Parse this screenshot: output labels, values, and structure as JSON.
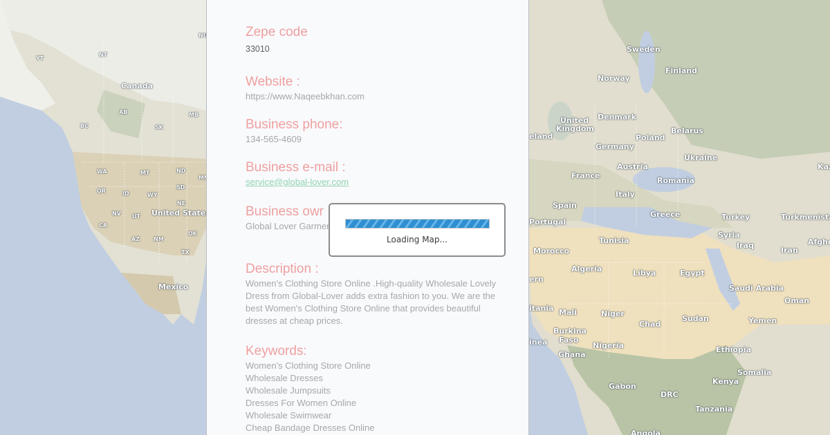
{
  "map": {
    "labels": [
      {
        "text": "NU",
        "tier": "s"
      },
      {
        "text": "NT",
        "tier": "s"
      },
      {
        "text": "YT",
        "tier": "s"
      },
      {
        "text": "Canada",
        "tier": "c"
      },
      {
        "text": "AB",
        "tier": "s"
      },
      {
        "text": "MB",
        "tier": "s"
      },
      {
        "text": "BC",
        "tier": "s"
      },
      {
        "text": "SK",
        "tier": "s"
      },
      {
        "text": "WA",
        "tier": "s"
      },
      {
        "text": "MT",
        "tier": "s"
      },
      {
        "text": "ND",
        "tier": "s"
      },
      {
        "text": "MN",
        "tier": "s"
      },
      {
        "text": "OR",
        "tier": "s"
      },
      {
        "text": "ID",
        "tier": "s"
      },
      {
        "text": "WY",
        "tier": "s"
      },
      {
        "text": "SD",
        "tier": "s"
      },
      {
        "text": "NE",
        "tier": "s"
      },
      {
        "text": "NV",
        "tier": "s"
      },
      {
        "text": "UT",
        "tier": "s"
      },
      {
        "text": "United States",
        "tier": "c"
      },
      {
        "text": "CA",
        "tier": "s"
      },
      {
        "text": "AZ",
        "tier": "s"
      },
      {
        "text": "NM",
        "tier": "s"
      },
      {
        "text": "OK",
        "tier": "s"
      },
      {
        "text": "TX",
        "tier": "s"
      },
      {
        "text": "Mexico",
        "tier": "c"
      },
      {
        "text": "Sweden",
        "tier": "c"
      },
      {
        "text": "Finland",
        "tier": "c"
      },
      {
        "text": "Norway",
        "tier": "c"
      },
      {
        "text": "United",
        "tier": "c"
      },
      {
        "text": "Kingdom",
        "tier": "c"
      },
      {
        "text": "Denmark",
        "tier": "c"
      },
      {
        "text": "Belarus",
        "tier": "c"
      },
      {
        "text": "eland",
        "tier": "c"
      },
      {
        "text": "Poland",
        "tier": "c"
      },
      {
        "text": "Germany",
        "tier": "c"
      },
      {
        "text": "Ukraine",
        "tier": "c"
      },
      {
        "text": "Kaz",
        "tier": "c"
      },
      {
        "text": "Austria",
        "tier": "c"
      },
      {
        "text": "France",
        "tier": "c"
      },
      {
        "text": "Romania",
        "tier": "c"
      },
      {
        "text": "Italy",
        "tier": "c"
      },
      {
        "text": "Spain",
        "tier": "c"
      },
      {
        "text": "Portugal",
        "tier": "c"
      },
      {
        "text": "Greece",
        "tier": "c"
      },
      {
        "text": "Turkey",
        "tier": "c"
      },
      {
        "text": "Turkmenista",
        "tier": "c"
      },
      {
        "text": "Tunisia",
        "tier": "c"
      },
      {
        "text": "Syria",
        "tier": "c"
      },
      {
        "text": "Iraq",
        "tier": "c"
      },
      {
        "text": "Afghe",
        "tier": "c"
      },
      {
        "text": "Morocco",
        "tier": "c"
      },
      {
        "text": "Iran",
        "tier": "c"
      },
      {
        "text": "Algeria",
        "tier": "c"
      },
      {
        "text": "Libya",
        "tier": "c"
      },
      {
        "text": "Egypt",
        "tier": "c"
      },
      {
        "text": "Saudi Arabia",
        "tier": "c"
      },
      {
        "text": "Oman",
        "tier": "c"
      },
      {
        "text": "Mali",
        "tier": "c"
      },
      {
        "text": "Niger",
        "tier": "c"
      },
      {
        "text": "Chad",
        "tier": "c"
      },
      {
        "text": "Sudan",
        "tier": "c"
      },
      {
        "text": "Yemen",
        "tier": "c"
      },
      {
        "text": "Burkina",
        "tier": "c"
      },
      {
        "text": "Faso",
        "tier": "c"
      },
      {
        "text": "Nigeria",
        "tier": "c"
      },
      {
        "text": "Ethiopia",
        "tier": "c"
      },
      {
        "text": "Ghana",
        "tier": "c"
      },
      {
        "text": "Kenya",
        "tier": "c"
      },
      {
        "text": "Somalia",
        "tier": "c"
      },
      {
        "text": "Gabon",
        "tier": "c"
      },
      {
        "text": "DRC",
        "tier": "c"
      },
      {
        "text": "Tanzania",
        "tier": "c"
      },
      {
        "text": "Angola",
        "tier": "c"
      },
      {
        "text": "ern",
        "tier": "c"
      },
      {
        "text": "itania",
        "tier": "c"
      },
      {
        "text": "inea",
        "tier": "c"
      }
    ]
  },
  "info": {
    "zip_heading": "Zepe code",
    "zip_value": "33010",
    "website_heading": "Website :",
    "website_value": "https://www.Naqeebkhan.com",
    "phone_heading": "Business phone:",
    "phone_value": "134-565-4609",
    "email_heading": "Business e-mail :",
    "email_value": "service@global-lover.com",
    "owner_heading": "Business owr",
    "owner_value": "Global Lover Garmer",
    "description_heading": "Description :",
    "description_value": "Women's Clothing Store Online .High-quality Wholesale Lovely Dress from Global-Lover adds extra fashion to you. We are the best Women's Clothing Store Online that provides beautiful dresses at cheap prices.",
    "keywords_heading": "Keywords:",
    "keywords": [
      "Women's Clothing Store Online",
      "Wholesale Dresses",
      "Wholesale Jumpsuits",
      "Dresses For Women Online",
      "Wholesale Swimwear",
      "Cheap Bandage Dresses Online"
    ]
  },
  "loading": {
    "text": "Loading Map...",
    "progress_percent": 100
  }
}
